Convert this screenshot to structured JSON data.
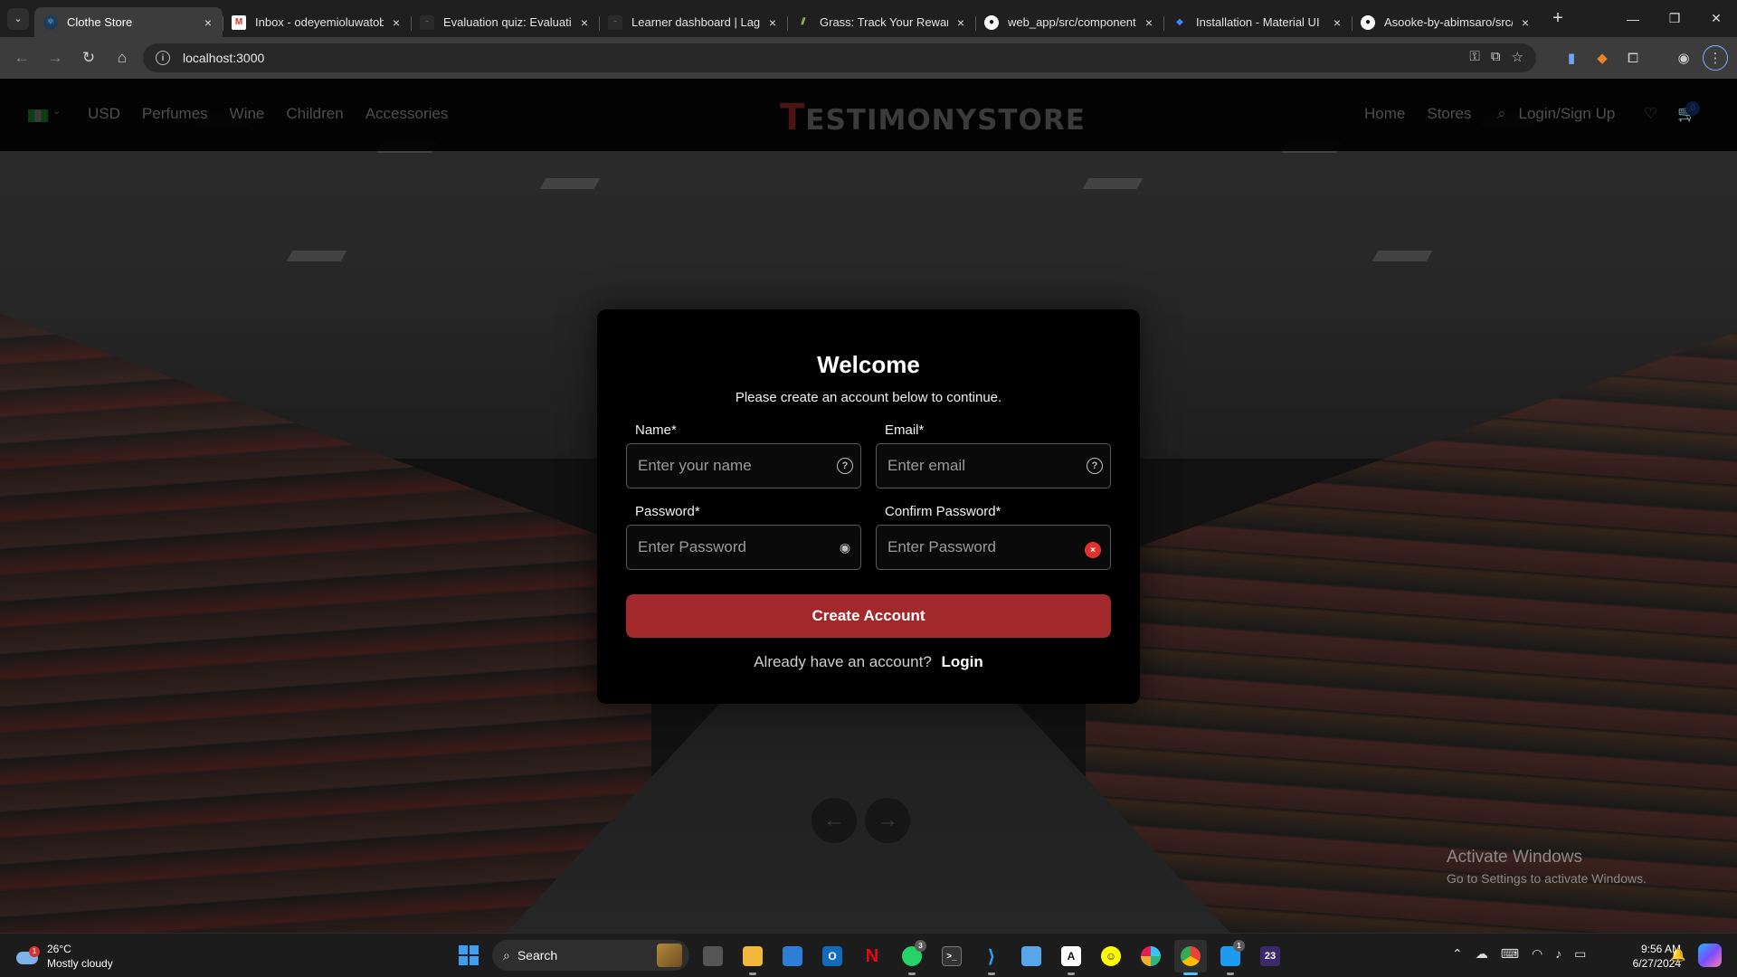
{
  "browser": {
    "tabs": [
      {
        "title": "Clothe Store",
        "icon": "react-atom-icon",
        "active": true
      },
      {
        "title": "Inbox - odeyemioluwatob",
        "icon": "gmail-icon",
        "active": false
      },
      {
        "title": "Evaluation quiz: Evaluatio",
        "icon": "lagos-icon",
        "active": false
      },
      {
        "title": "Learner dashboard | Lago",
        "icon": "lagos-icon",
        "active": false
      },
      {
        "title": "Grass: Track Your Rewards",
        "icon": "grass-icon",
        "active": false
      },
      {
        "title": "web_app/src/component",
        "icon": "github-icon",
        "active": false
      },
      {
        "title": "Installation - Material UI",
        "icon": "mui-icon",
        "active": false
      },
      {
        "title": "Asooke-by-abimsaro/src/",
        "icon": "github-icon",
        "active": false
      }
    ],
    "url": "localhost:3000"
  },
  "site": {
    "nav_left": [
      "USD",
      "Perfumes",
      "Wine",
      "Children",
      "Accessories"
    ],
    "logo_first": "T",
    "logo_rest": "ESTIMONYSTORE",
    "nav_right": [
      "Home",
      "Stores",
      "Login/Sign Up"
    ],
    "cart_count": "0"
  },
  "modal": {
    "title": "Welcome",
    "subtitle": "Please create an account below to continue.",
    "name_label": "Name*",
    "name_placeholder": "Enter your name",
    "email_label": "Email*",
    "email_placeholder": "Enter email",
    "password_label": "Password*",
    "password_placeholder": "Enter Password",
    "confirm_label": "Confirm Password*",
    "confirm_placeholder": "Enter Password",
    "submit_label": "Create Account",
    "login_prompt": "Already have an account?",
    "login_link": "Login"
  },
  "watermark": {
    "line1": "Activate Windows",
    "line2": "Go to Settings to activate Windows."
  },
  "taskbar": {
    "weather_temp": "26°C",
    "weather_desc": "Mostly cloudy",
    "weather_badge": "1",
    "search_label": "Search",
    "time": "9:56 AM",
    "date": "6/27/2024",
    "whatsapp_badge": "3",
    "twitter_badge": "1"
  }
}
